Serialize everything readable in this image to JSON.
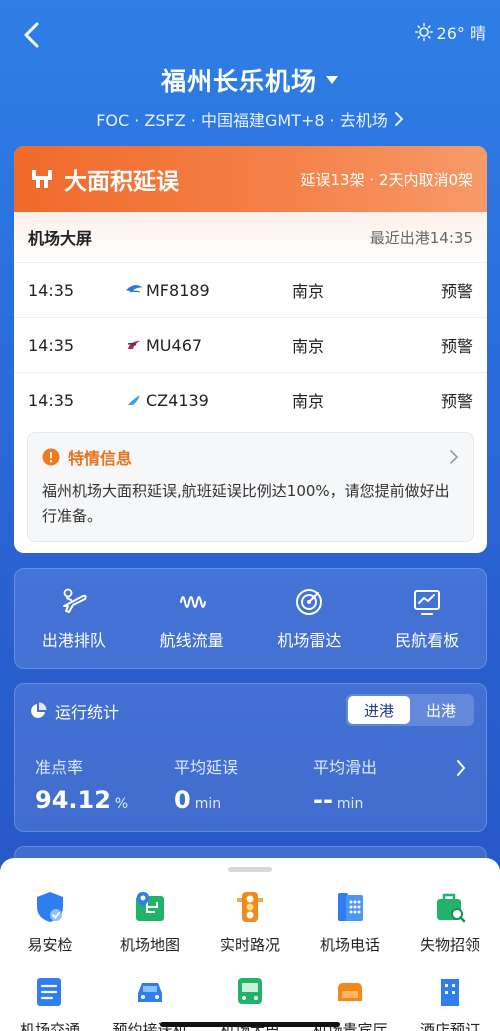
{
  "header": {
    "weather": "26° 晴",
    "title": "福州长乐机场",
    "codes": "FOC · ZSFZ · 中国福建GMT+8 · 去机场"
  },
  "alert": {
    "title": "大面积延误",
    "stats": "延误13架 · 2天内取消0架"
  },
  "board": {
    "title": "机场大屏",
    "latest": "最近出港14:35",
    "flights": [
      {
        "time": "14:35",
        "no": "MF8189",
        "city": "南京",
        "status": "预警",
        "airline_color": "#2a7dd6"
      },
      {
        "time": "14:35",
        "no": "MU467",
        "city": "南京",
        "status": "预警",
        "airline_color": "#c8202a"
      },
      {
        "time": "14:35",
        "no": "CZ4139",
        "city": "南京",
        "status": "预警",
        "airline_color": "#3aa0e4"
      }
    ]
  },
  "notice": {
    "title": "特情信息",
    "text": "福州机场大面积延误,航班延误比例达100%，请您提前做好出行准备。"
  },
  "tools": [
    {
      "label": "出港排队",
      "icon": "departure-queue-icon"
    },
    {
      "label": "航线流量",
      "icon": "route-flow-icon"
    },
    {
      "label": "机场雷达",
      "icon": "radar-icon"
    },
    {
      "label": "民航看板",
      "icon": "dashboard-icon"
    }
  ],
  "stats": {
    "title": "运行统计",
    "tabs": [
      "进港",
      "出港"
    ],
    "active_tab": "进港",
    "metrics": [
      {
        "label": "准点率",
        "value": "94.12",
        "unit": "%"
      },
      {
        "label": "平均延误",
        "value": "0",
        "unit": "min"
      },
      {
        "label": "平均滑出",
        "value": "--",
        "unit": "min"
      }
    ]
  },
  "services": {
    "row1": [
      {
        "label": "易安检",
        "icon": "security-check-icon"
      },
      {
        "label": "机场地图",
        "icon": "airport-map-icon"
      },
      {
        "label": "实时路况",
        "icon": "traffic-light-icon"
      },
      {
        "label": "机场电话",
        "icon": "phone-icon"
      },
      {
        "label": "失物招领",
        "icon": "lost-found-icon"
      }
    ],
    "row2": [
      {
        "label": "机场交通",
        "icon": "transport-icon"
      },
      {
        "label": "预约接送机",
        "icon": "car-icon"
      },
      {
        "label": "机场大巴",
        "icon": "bus-icon"
      },
      {
        "label": "机场贵宾厅",
        "icon": "vip-lounge-icon"
      },
      {
        "label": "酒店预订",
        "icon": "hotel-icon"
      }
    ]
  },
  "colors": {
    "accent_orange": "#f06a2b",
    "background_blue": "#2a6fdc",
    "notice_orange": "#e8731a"
  }
}
